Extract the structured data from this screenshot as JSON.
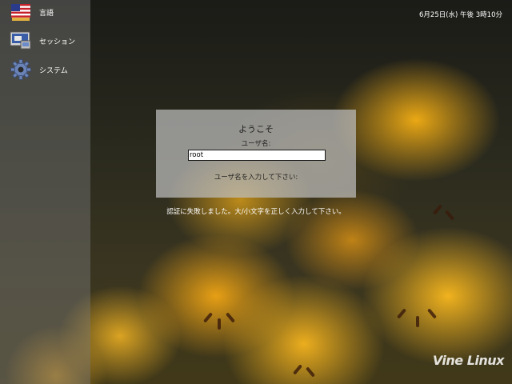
{
  "sidebar": {
    "items": [
      {
        "label": "言語",
        "icon": "us-flag-icon"
      },
      {
        "label": "セッション",
        "icon": "session-icon"
      },
      {
        "label": "システム",
        "icon": "system-gear-icon"
      }
    ]
  },
  "clock": "6月25日(水) 午後 3時10分",
  "login": {
    "welcome": "ようこそ",
    "user_label": "ユーザ名:",
    "username_value": "root",
    "prompt": "ユーザ名を入力して下さい:"
  },
  "error_message": "認証に失敗しました。大/小文字を正しく入力して下さい。",
  "brand": "Vine Linux"
}
